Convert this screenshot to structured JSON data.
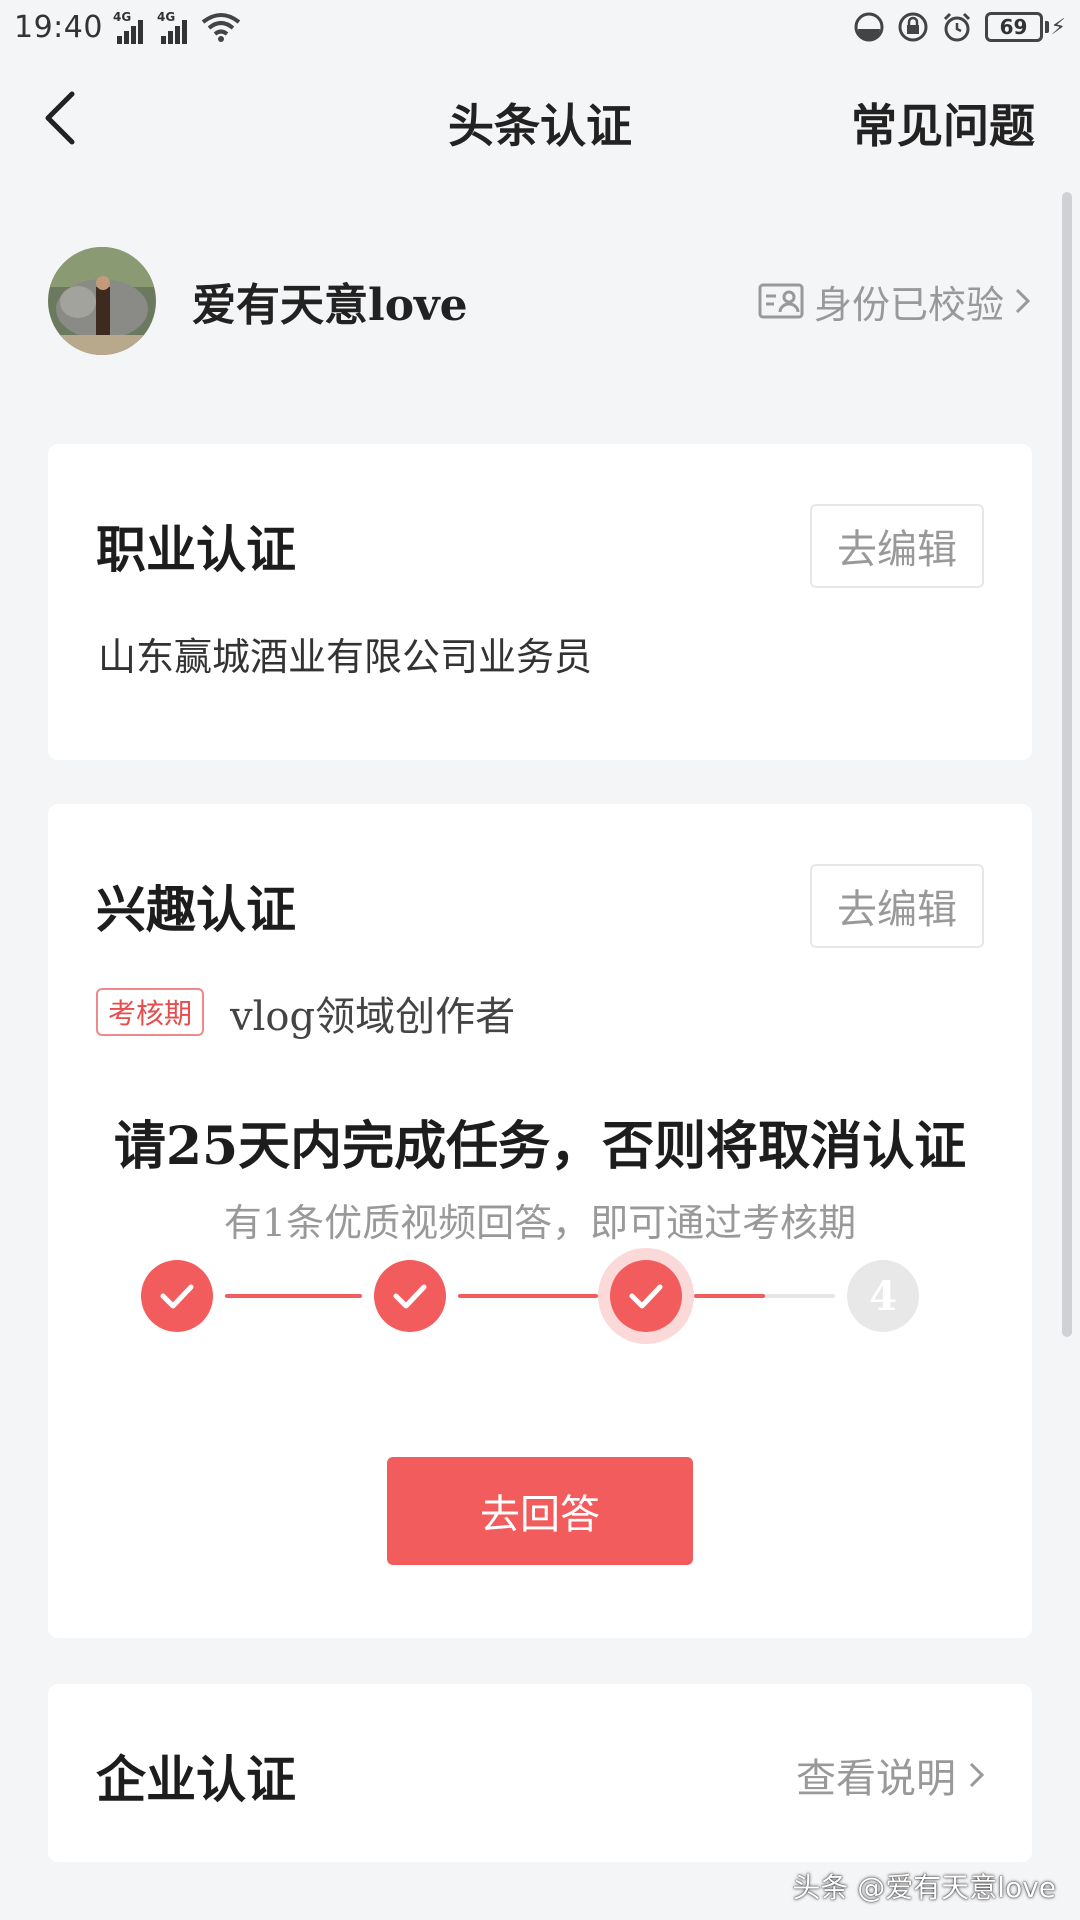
{
  "status_bar": {
    "time": "19:40",
    "network_1": "4G",
    "network_2": "4G",
    "battery": "69"
  },
  "nav": {
    "title": "头条认证",
    "faq": "常见问题"
  },
  "profile": {
    "username": "爱有天意love",
    "verify_label": "身份已校验"
  },
  "career": {
    "title": "职业认证",
    "edit_label": "去编辑",
    "description": "山东赢城酒业有限公司业务员"
  },
  "interest": {
    "title": "兴趣认证",
    "edit_label": "去编辑",
    "badge": "考核期",
    "field": "vlog领域创作者",
    "task_title": "请25天内完成任务，否则将取消认证",
    "task_subtitle": "有1条优质视频回答，即可通过考核期",
    "steps": {
      "completed": 3,
      "total": 4,
      "pending_label": "4",
      "progress_to_next": 0.5
    },
    "answer_label": "去回答"
  },
  "enterprise": {
    "title": "企业认证",
    "explain_label": "查看说明"
  },
  "watermark": "头条 @爱有天意love",
  "colors": {
    "accent": "#f25c5c",
    "background": "#f4f5f7",
    "muted_text": "#999999"
  }
}
